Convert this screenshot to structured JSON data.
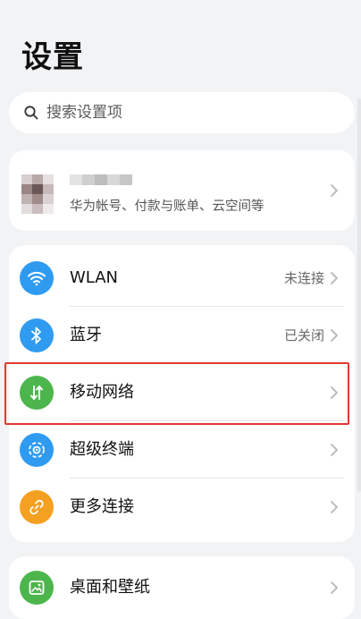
{
  "header": {
    "title": "设置"
  },
  "search": {
    "placeholder": "搜索设置项",
    "value": ""
  },
  "account": {
    "subtitle": "华为帐号、付款与账单、云空间等"
  },
  "settings": [
    {
      "id": "wlan",
      "label": "WLAN",
      "value": "未连接",
      "icon": "wifi-icon",
      "color": "#2f9bf0"
    },
    {
      "id": "bluetooth",
      "label": "蓝牙",
      "value": "已关闭",
      "icon": "bluetooth-icon",
      "color": "#2f9bf0"
    },
    {
      "id": "mobile-network",
      "label": "移动网络",
      "value": "",
      "icon": "mobile-data-icon",
      "color": "#4cb64c"
    },
    {
      "id": "super-device",
      "label": "超级终端",
      "value": "",
      "icon": "super-device-icon",
      "color": "#2f9bf0"
    },
    {
      "id": "more-connections",
      "label": "更多连接",
      "value": "",
      "icon": "link-icon",
      "color": "#f4a020"
    }
  ],
  "display_section": [
    {
      "id": "wallpaper",
      "label": "桌面和壁纸",
      "value": "",
      "icon": "wallpaper-icon",
      "color": "#4cb64c"
    }
  ],
  "colors": {
    "highlight": "#e23a2e",
    "background": "#f1f3f5"
  }
}
